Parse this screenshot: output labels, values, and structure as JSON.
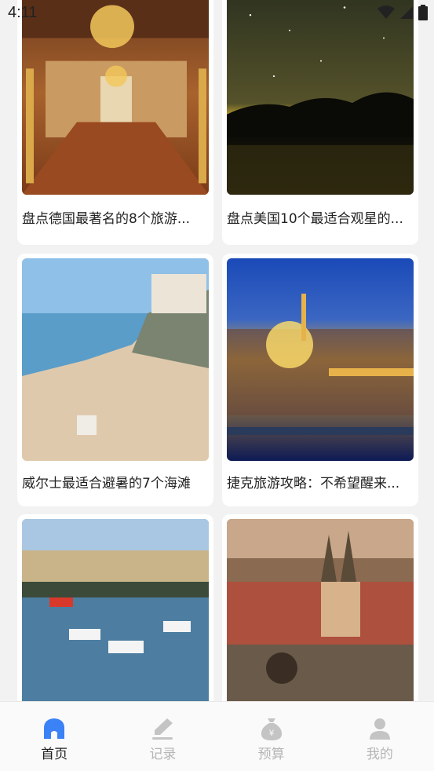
{
  "status_bar": {
    "time": "4:11"
  },
  "feed": {
    "articles": [
      {
        "title": "盘点德国最著名的8个旅游..."
      },
      {
        "title": "盘点美国10个最适合观星的..."
      },
      {
        "title": "威尔士最适合避暑的7个海滩"
      },
      {
        "title": "捷克旅游攻略：不希望醒来..."
      },
      {
        "title": ""
      },
      {
        "title": ""
      }
    ]
  },
  "bottom_nav": {
    "items": [
      {
        "label": "首页",
        "icon": "home-icon",
        "active": true
      },
      {
        "label": "记录",
        "icon": "pencil-icon",
        "active": false
      },
      {
        "label": "预算",
        "icon": "money-bag-icon",
        "active": false
      },
      {
        "label": "我的",
        "icon": "person-icon",
        "active": false
      }
    ]
  },
  "colors": {
    "accent": "#3b82f6",
    "inactive": "#b5b5b5"
  }
}
